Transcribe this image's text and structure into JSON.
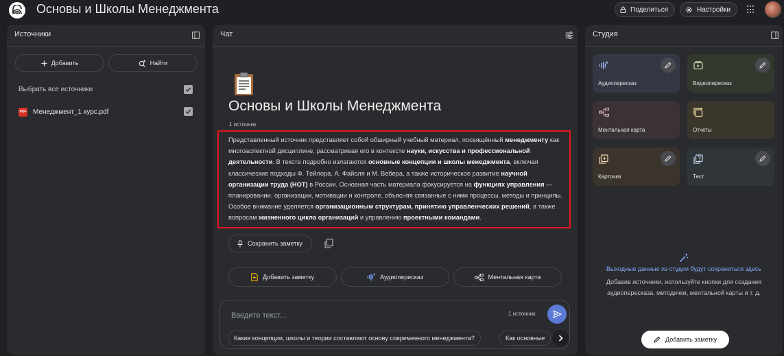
{
  "app": {
    "title": "Основы и Школы Менеджмента"
  },
  "topbar": {
    "share_label": "Поделиться",
    "settings_label": "Настройки"
  },
  "sources": {
    "title": "Источники",
    "add_label": "Добавить",
    "find_label": "Найти",
    "select_all_label": "Выбрать все источники",
    "files": [
      {
        "name": "Менеджмент_1 курс.pdf",
        "checked": true
      }
    ]
  },
  "chat": {
    "title": "Чат",
    "notebook_title": "Основы и Школы Менеджмента",
    "source_count": "1 источник",
    "summary_parts": [
      {
        "t": "Представленный источник представляет собой обширный учебный материал, посвящённый "
      },
      {
        "t": "менеджменту",
        "b": true
      },
      {
        "t": " как многоаспектной дисциплине, рассматривая его в контексте "
      },
      {
        "t": "науки, искусства и профессиональной деятельности",
        "b": true
      },
      {
        "t": ". В тексте подробно излагаются "
      },
      {
        "t": "основные концепции и школы менеджмента",
        "b": true
      },
      {
        "t": ", включая классические подходы Ф. Тейлора, А. Файоля и М. Вебера, а также историческое развитие "
      },
      {
        "t": "научной организации труда (НОТ)",
        "b": true
      },
      {
        "t": " в России. Основная часть материала фокусируется на "
      },
      {
        "t": "функциях управления",
        "b": true
      },
      {
        "t": " — планировании, организации, мотивации и контроле, объясняя связанные с ними процессы, методы и принципы. Особое внимание уделяется "
      },
      {
        "t": "организационным структурам, принятию управленческих решений",
        "b": true
      },
      {
        "t": ", а также вопросам "
      },
      {
        "t": "жизненного цикла организаций",
        "b": true
      },
      {
        "t": " и управлению "
      },
      {
        "t": "проектными командами",
        "b": true
      },
      {
        "t": "."
      }
    ],
    "save_note_label": "Сохранить заметку",
    "actions": {
      "add_note": "Добавить заметку",
      "audio": "Аудиопересказ",
      "mindmap": "Ментальная карта"
    },
    "input_placeholder": "Введите текст...",
    "input_source_count": "1 источник",
    "suggestions": [
      "Какие концепции, школы и теории составляют основу современного менеджмента?",
      "Как основные"
    ]
  },
  "studio": {
    "title": "Студия",
    "tiles": {
      "audio": "Аудиопересказ",
      "video": "Видеопересказ",
      "mindmap": "Ментальная карта",
      "reports": "Отчеты",
      "cards": "Карточки",
      "test": "Тест"
    },
    "empty_title": "Выходные данные из студии будут сохраняться здесь",
    "empty_subtitle": "Добавив источники, используйте кнопки для создания аудиопересказа, методички, ментальной карты и т. д.",
    "add_note_label": "Добавить заметку"
  },
  "colors": {
    "accent": "#5b7bd6",
    "highlight_border": "#e3181f",
    "studio_empty_title": "#7ea6f7"
  }
}
